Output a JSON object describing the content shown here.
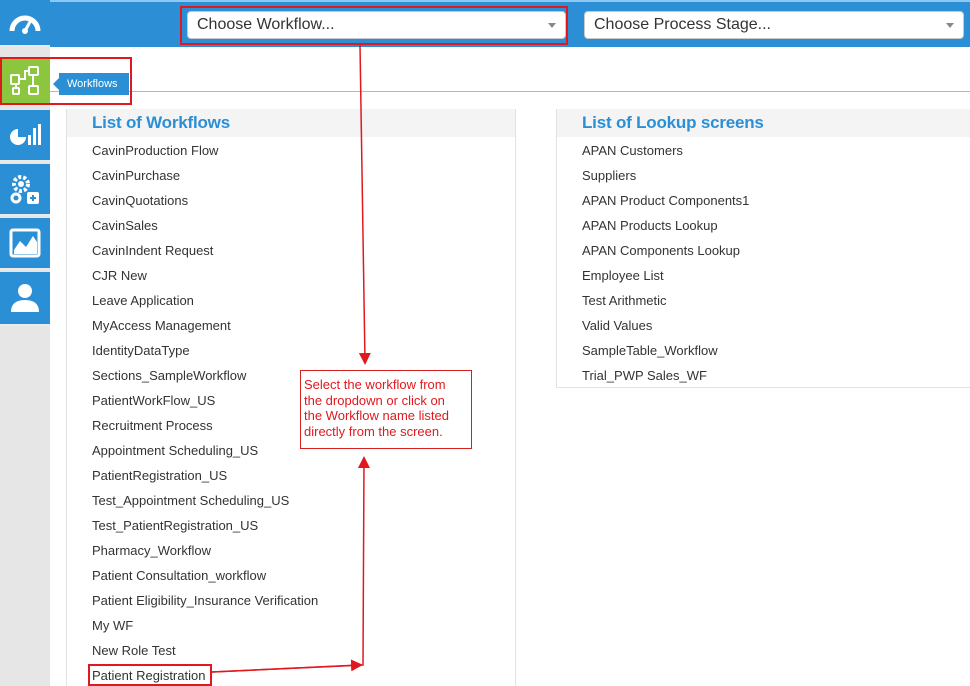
{
  "topbar": {
    "workflow_select": {
      "placeholder": "Choose Workflow..."
    },
    "stage_select": {
      "placeholder": "Choose Process Stage..."
    }
  },
  "sidebar": {
    "items": [
      {
        "icon": "dashboard-icon"
      },
      {
        "icon": "workflows-icon",
        "active": true,
        "tooltip": "Workflows"
      },
      {
        "icon": "reports-icon"
      },
      {
        "icon": "settings-icon"
      },
      {
        "icon": "analytics-icon"
      },
      {
        "icon": "user-icon"
      }
    ]
  },
  "workflows": {
    "title": "List of Workflows",
    "items": [
      "CavinProduction Flow",
      "CavinPurchase",
      "CavinQuotations",
      "CavinSales",
      "CavinIndent Request",
      "CJR New",
      "Leave Application",
      "MyAccess Management",
      "IdentityDataType",
      "Sections_SampleWorkflow",
      "PatientWorkFlow_US",
      "Recruitment Process",
      "Appointment Scheduling_US",
      "PatientRegistration_US",
      "Test_Appointment Scheduling_US",
      "Test_PatientRegistration_US",
      "Pharmacy_Workflow",
      "Patient Consultation_workflow",
      "Patient Eligibility_Insurance Verification",
      "My WF",
      "New Role Test",
      "Patient Registration"
    ]
  },
  "lookups": {
    "title": "List of Lookup screens",
    "items": [
      "APAN Customers",
      "Suppliers",
      "APAN Product Components1",
      "APAN Products Lookup",
      "APAN Components Lookup",
      "Employee List",
      "Test Arithmetic",
      "Valid Values",
      "SampleTable_Workflow",
      "Trial_PWP Sales_WF"
    ]
  },
  "annotation": {
    "callout_text": "Select the workflow from\nthe dropdown or click on\nthe Workflow name listed\ndirectly from the screen."
  },
  "colors": {
    "primary": "#2b8fd6",
    "active": "#8cc63f",
    "annotation": "#e0191f"
  }
}
